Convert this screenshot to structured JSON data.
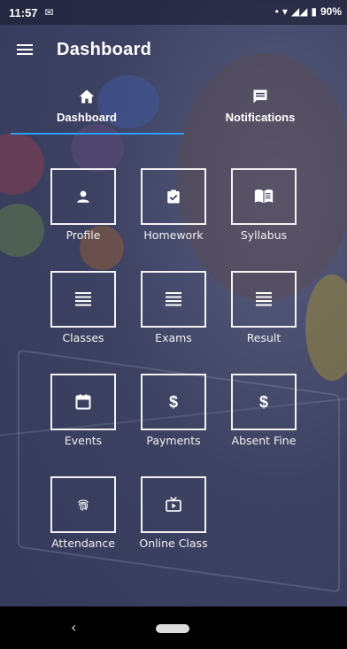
{
  "status": {
    "time": "11:57",
    "battery": "90%"
  },
  "appbar": {
    "title": "Dashboard"
  },
  "tabs": [
    {
      "label": "Dashboard",
      "icon": "home-icon"
    },
    {
      "label": "Notifications",
      "icon": "message-icon"
    }
  ],
  "tiles": [
    {
      "label": "Profile",
      "icon": "person-icon"
    },
    {
      "label": "Homework",
      "icon": "clipboard-check-icon"
    },
    {
      "label": "Syllabus",
      "icon": "book-icon"
    },
    {
      "label": "Classes",
      "icon": "list-icon"
    },
    {
      "label": "Exams",
      "icon": "list-icon"
    },
    {
      "label": "Result",
      "icon": "list-icon"
    },
    {
      "label": "Events",
      "icon": "calendar-icon"
    },
    {
      "label": "Payments",
      "icon": "dollar-icon",
      "glyph": "$"
    },
    {
      "label": "Absent Fine",
      "icon": "dollar-icon",
      "glyph": "$"
    },
    {
      "label": "Attendance",
      "icon": "fingerprint-icon"
    },
    {
      "label": "Online Class",
      "icon": "live-tv-icon"
    }
  ],
  "colors": {
    "accent": "#2a9df4",
    "tile_border": "#f2f2f2"
  },
  "navbar": {
    "back": "‹"
  }
}
